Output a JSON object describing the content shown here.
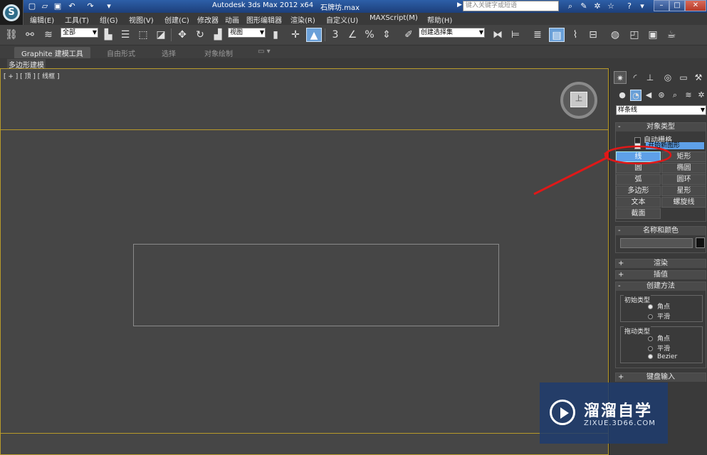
{
  "window": {
    "title": "Autodesk 3ds Max  2012 x64",
    "file": "石牌坊.max",
    "help_search_placeholder": "键入关键字或短语",
    "min_label": "–",
    "max_label": "□",
    "close_label": "✕"
  },
  "app_logo": "S",
  "menu": [
    "编辑(E)",
    "工具(T)",
    "组(G)",
    "视图(V)",
    "创建(C)",
    "修改器",
    "动画",
    "图形编辑器",
    "渲染(R)",
    "自定义(U)",
    "MAXScript(M)",
    "帮助(H)"
  ],
  "toolbar": {
    "selection_filter": "全部",
    "reference_coord": "视图",
    "named_selection": "创建选择集",
    "snap_label": "3",
    "percent_snap_label": "%",
    "active_tool": "select-and-place"
  },
  "ribbon": {
    "tabs": [
      "Graphite 建模工具",
      "自由形式",
      "选择",
      "对象绘制"
    ],
    "sub_label": "多边形建模"
  },
  "viewport": {
    "label": "[ + ] [ 顶 ] [ 线框 ]",
    "viewcube_face": "上"
  },
  "command_panel": {
    "category": "样条线",
    "object_type": {
      "header": "对象类型",
      "sign": "-",
      "autogrid_label": "自动栅格",
      "autogrid_checked": false,
      "start_new_shape_label": "开始新图形",
      "start_new_shape_checked": true,
      "buttons": [
        {
          "label": "线",
          "active": true
        },
        {
          "label": "矩形",
          "active": false
        },
        {
          "label": "圆",
          "active": false
        },
        {
          "label": "椭圆",
          "active": false
        },
        {
          "label": "弧",
          "active": false
        },
        {
          "label": "圆环",
          "active": false
        },
        {
          "label": "多边形",
          "active": false
        },
        {
          "label": "星形",
          "active": false
        },
        {
          "label": "文本",
          "active": false
        },
        {
          "label": "螺旋线",
          "active": false
        },
        {
          "label": "截面",
          "active": false
        }
      ]
    },
    "name_color": {
      "header": "名称和颜色",
      "sign": "-",
      "name_value": "",
      "swatch_color": "#111111"
    },
    "rendering": {
      "header": "渲染",
      "sign": "+"
    },
    "interpolation": {
      "header": "插值",
      "sign": "+"
    },
    "creation_method": {
      "header": "创建方法",
      "sign": "-",
      "initial_type": {
        "title": "初始类型",
        "options": [
          "角点",
          "平滑"
        ],
        "selected": "角点"
      },
      "drag_type": {
        "title": "拖动类型",
        "options": [
          "角点",
          "平滑",
          "Bezier"
        ],
        "selected": "Bezier"
      }
    },
    "keyboard_entry": {
      "header": "键盘输入",
      "sign": "+"
    }
  },
  "watermark": {
    "name": "溜溜自学",
    "url": "ZIXUE.3D66.COM"
  },
  "colors": {
    "accent": "#5ea0e8",
    "viewport_border": "#b89a2a",
    "annotation": "#e01818"
  }
}
